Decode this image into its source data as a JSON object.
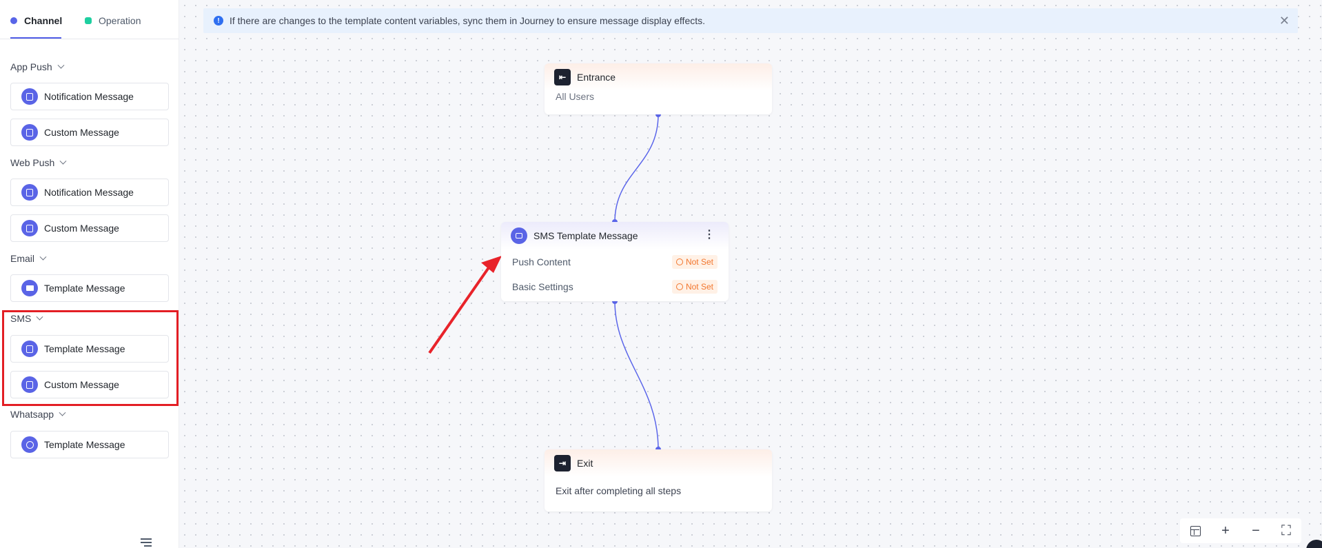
{
  "tabs": {
    "channel": "Channel",
    "operation": "Operation"
  },
  "sidebar": {
    "sections": [
      {
        "label": "App Push",
        "items": [
          "Notification Message",
          "Custom Message"
        ]
      },
      {
        "label": "Web Push",
        "items": [
          "Notification Message",
          "Custom Message"
        ]
      },
      {
        "label": "Email",
        "items": [
          "Template Message"
        ]
      },
      {
        "label": "SMS",
        "items": [
          "Template Message",
          "Custom Message"
        ]
      },
      {
        "label": "Whatsapp",
        "items": [
          "Template Message"
        ]
      }
    ]
  },
  "banner": {
    "text": "If there are changes to the template content variables, sync them in Journey to ensure message display effects."
  },
  "nodes": {
    "entrance": {
      "title": "Entrance",
      "sub": "All Users"
    },
    "sms": {
      "title": "SMS Template Message",
      "rows": [
        {
          "label": "Push Content",
          "status": "Not Set"
        },
        {
          "label": "Basic Settings",
          "status": "Not Set"
        }
      ]
    },
    "exit": {
      "title": "Exit",
      "sub": "Exit after completing all steps"
    }
  },
  "colors": {
    "accent": "#5a64e6",
    "connector": "#5b66ea",
    "warning": "#f2762e",
    "highlight": "#e31e24"
  }
}
